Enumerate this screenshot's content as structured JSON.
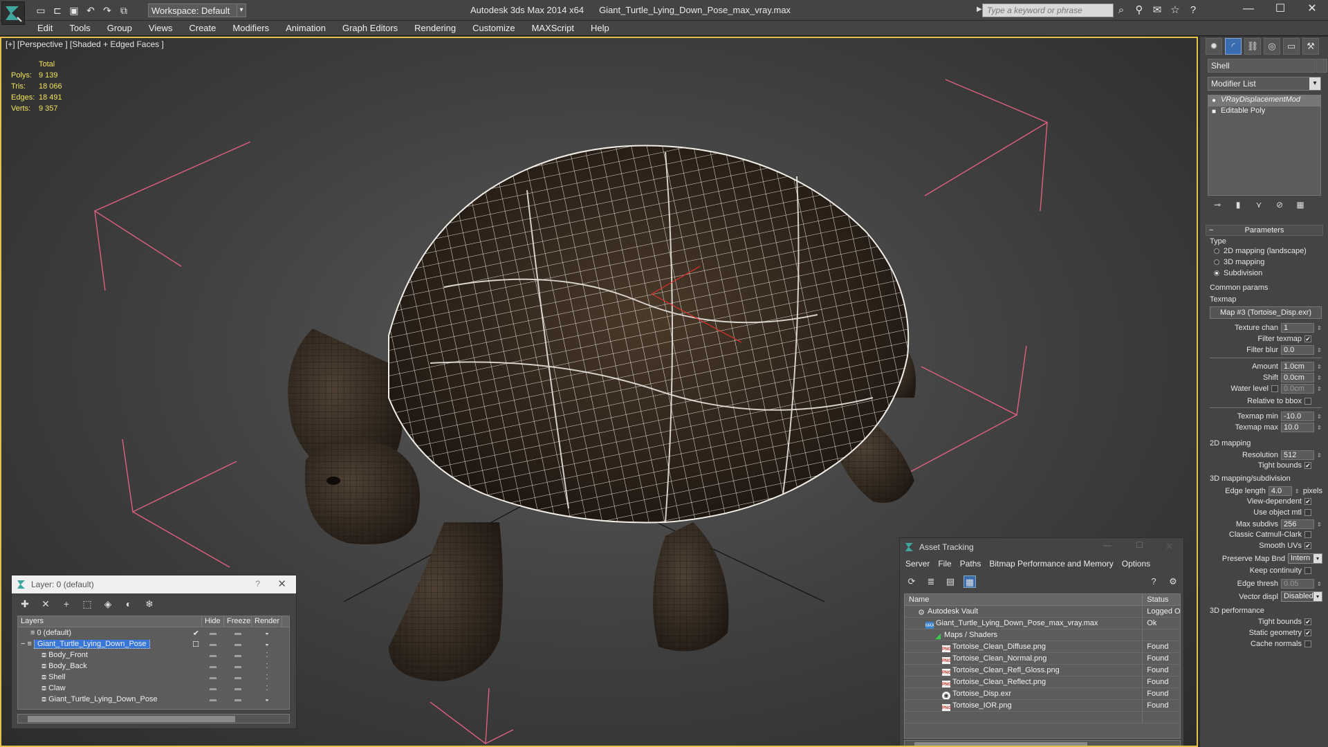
{
  "app": {
    "name": "Autodesk 3ds Max  2014 x64",
    "file": "Giant_Turtle_Lying_Down_Pose_max_vray.max",
    "workspace": "Workspace: Default",
    "search_placeholder": "Type a keyword or phrase"
  },
  "menu": [
    "Edit",
    "Tools",
    "Group",
    "Views",
    "Create",
    "Modifiers",
    "Animation",
    "Graph Editors",
    "Rendering",
    "Customize",
    "MAXScript",
    "Help"
  ],
  "viewport": {
    "label": "[+] [Perspective ] [Shaded + Edged Faces ]",
    "stats": {
      "header": "Total",
      "rows": [
        {
          "label": "Polys:",
          "value": "9 139"
        },
        {
          "label": "Tris:",
          "value": "18 066"
        },
        {
          "label": "Edges:",
          "value": "18 491"
        },
        {
          "label": "Verts:",
          "value": "9 357"
        }
      ]
    }
  },
  "command_panel": {
    "object_name": "Shell",
    "modifier_list": "Modifier List",
    "stack": [
      {
        "label": "VRayDisplacementMod",
        "selected": true
      },
      {
        "label": "Editable Poly",
        "selected": false
      }
    ],
    "parameters": {
      "title": "Parameters",
      "type_label": "Type",
      "type_options": [
        "2D mapping (landscape)",
        "3D mapping",
        "Subdivision"
      ],
      "type_selected": "Subdivision",
      "common_params": "Common params",
      "texmap_label": "Texmap",
      "texmap_value": "Map #3 (Tortoise_Disp.exr)",
      "texture_chan_label": "Texture chan",
      "texture_chan": "1",
      "filter_texmap": "Filter texmap",
      "filter_blur_label": "Filter blur",
      "filter_blur": "0.0",
      "amount_label": "Amount",
      "amount": "1.0cm",
      "shift_label": "Shift",
      "shift": "0.0cm",
      "water_level_label": "Water level",
      "water_level": "0.0cm",
      "relative_to_bbox": "Relative to bbox",
      "texmap_min_label": "Texmap min",
      "texmap_min": "-10.0",
      "texmap_max_label": "Texmap max",
      "texmap_max": "10.0",
      "mapping_2d": "2D mapping",
      "resolution_label": "Resolution",
      "resolution": "512",
      "tight_bounds": "Tight bounds",
      "mapping_3d": "3D mapping/subdivision",
      "edge_length_label": "Edge length",
      "edge_length": "4.0",
      "pixels": "pixels",
      "view_dependent": "View-dependent",
      "use_object_mtl": "Use object mtl",
      "max_subdivs_label": "Max subdivs",
      "max_subdivs": "256",
      "classic_catmull": "Classic Catmull-Clark",
      "smooth_uvs": "Smooth UVs",
      "preserve_map_bnd_label": "Preserve Map Bnd",
      "preserve_map_bnd": "Intern",
      "keep_continuity": "Keep continuity",
      "edge_thresh_label": "Edge thresh",
      "edge_thresh": "0.05",
      "vector_displ_label": "Vector displ",
      "vector_displ": "Disabled",
      "performance_3d": "3D performance",
      "tight_bounds_2": "Tight bounds",
      "static_geometry": "Static geometry",
      "cache_normals": "Cache normals"
    }
  },
  "layer_window": {
    "title": "Layer: 0 (default)",
    "help": "?",
    "columns": [
      "Layers",
      "Hide",
      "Freeze",
      "Render"
    ],
    "rows": [
      {
        "name": "0 (default)",
        "indent": 1,
        "selected": false
      },
      {
        "name": "Giant_Turtle_Lying_Down_Pose",
        "indent": 1,
        "selected": true
      },
      {
        "name": "Body_Front",
        "indent": 2,
        "selected": false
      },
      {
        "name": "Body_Back",
        "indent": 2,
        "selected": false
      },
      {
        "name": "Shell",
        "indent": 2,
        "selected": false
      },
      {
        "name": "Claw",
        "indent": 2,
        "selected": false
      },
      {
        "name": "Giant_Turtle_Lying_Down_Pose",
        "indent": 2,
        "selected": false
      }
    ]
  },
  "asset_window": {
    "title": "Asset Tracking",
    "menu": [
      "Server",
      "File",
      "Paths",
      "Bitmap Performance and Memory",
      "Options"
    ],
    "columns": [
      "Name",
      "Status"
    ],
    "rows": [
      {
        "name": "Autodesk Vault",
        "status": "Logged O",
        "icon": "vault",
        "indent": 1
      },
      {
        "name": "Giant_Turtle_Lying_Down_Pose_max_vray.max",
        "status": "Ok",
        "icon": "max",
        "indent": 2
      },
      {
        "name": "Maps / Shaders",
        "status": "",
        "icon": "folder",
        "indent": 3
      },
      {
        "name": "Tortoise_Clean_Diffuse.png",
        "status": "Found",
        "icon": "png",
        "indent": 4
      },
      {
        "name": "Tortoise_Clean_Normal.png",
        "status": "Found",
        "icon": "png",
        "indent": 4
      },
      {
        "name": "Tortoise_Clean_Refl_Gloss.png",
        "status": "Found",
        "icon": "png",
        "indent": 4
      },
      {
        "name": "Tortoise_Clean_Reflect.png",
        "status": "Found",
        "icon": "png",
        "indent": 4
      },
      {
        "name": "Tortoise_Disp.exr",
        "status": "Found",
        "icon": "exr",
        "indent": 4
      },
      {
        "name": "Tortoise_IOR.png",
        "status": "Found",
        "icon": "png",
        "indent": 4
      }
    ]
  },
  "colors": {
    "ui_bg": "#444444",
    "viewport_border": "#e8c14a",
    "stats_text": "#f2e45a",
    "bbox_lines": "#e0607f",
    "selection": "#3876d8"
  }
}
